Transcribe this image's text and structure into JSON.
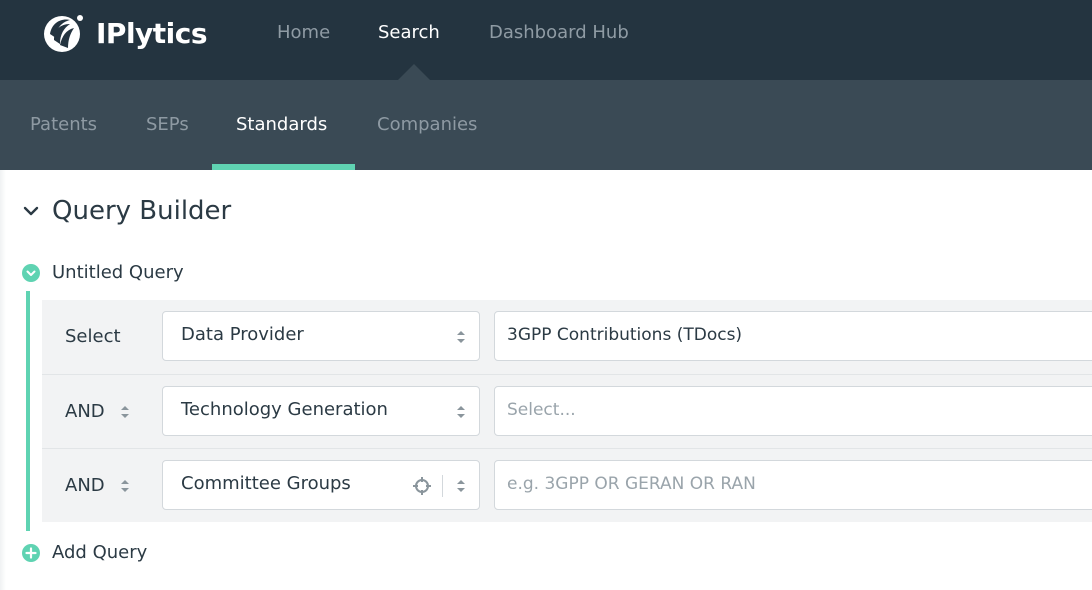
{
  "brand": {
    "name": "IPlytics"
  },
  "top_nav": {
    "items": [
      {
        "label": "Home",
        "active": false
      },
      {
        "label": "Search",
        "active": true
      },
      {
        "label": "Dashboard Hub",
        "active": false
      }
    ]
  },
  "sub_nav": {
    "items": [
      {
        "label": "Patents",
        "active": false
      },
      {
        "label": "SEPs",
        "active": false
      },
      {
        "label": "Standards",
        "active": true
      },
      {
        "label": "Companies",
        "active": false
      }
    ]
  },
  "query_builder": {
    "title": "Query Builder",
    "query_name": "Untitled Query",
    "add_query_label": "Add Query",
    "rows": [
      {
        "operator": "Select",
        "field": "Data Provider",
        "value": "3GPP Contributions (TDocs)",
        "placeholder": ""
      },
      {
        "operator": "AND",
        "field": "Technology Generation",
        "value": "",
        "placeholder": "Select..."
      },
      {
        "operator": "AND",
        "field": "Committee Groups",
        "value": "",
        "placeholder": "e.g. 3GPP OR GERAN OR RAN"
      }
    ]
  },
  "colors": {
    "topbar": "#243440",
    "subbar": "#3a4a55",
    "accent": "#5fd3b2"
  }
}
